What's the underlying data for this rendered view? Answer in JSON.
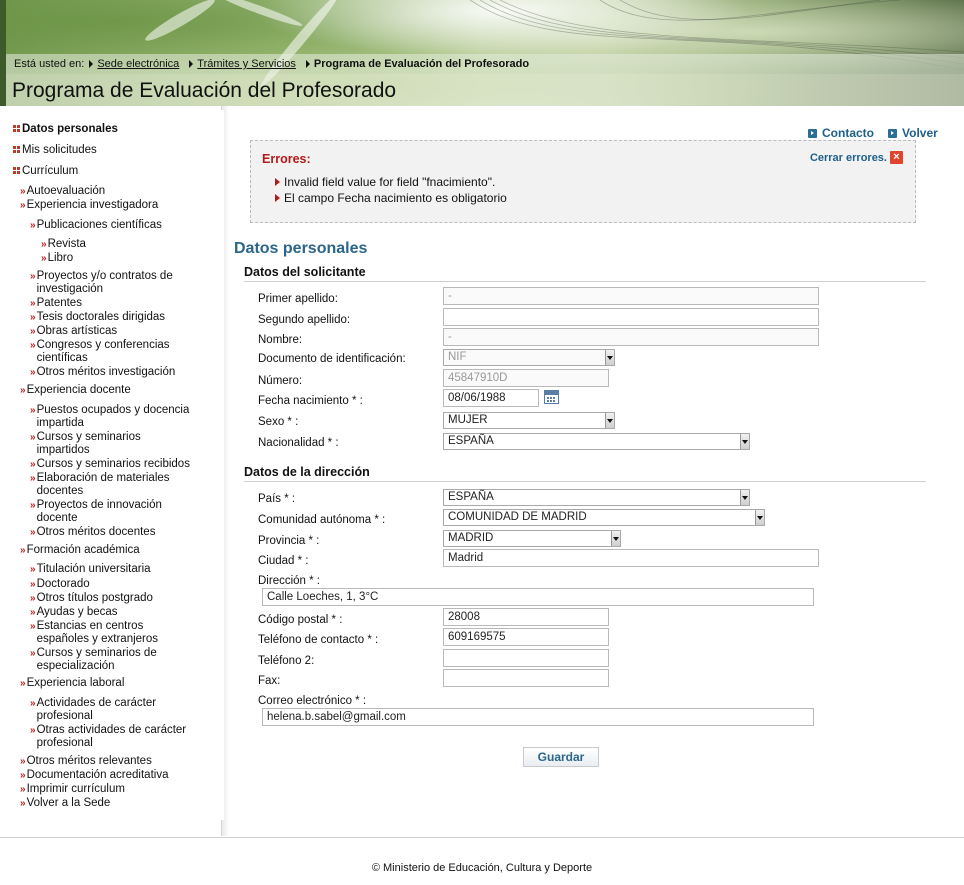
{
  "breadcrumb": {
    "prefix": "Está usted en:",
    "items": [
      "Sede electrónica",
      "Trámites y Servicios"
    ],
    "current": "Programa de Evaluación del Profesorado"
  },
  "page_title": "Programa de Evaluación del Profesorado",
  "sidebar": {
    "items": [
      {
        "label": "Datos personales"
      },
      {
        "label": "Mis solicitudes"
      },
      {
        "label": "Currículum"
      },
      {
        "label": "Autoevaluación"
      },
      {
        "label": "Experiencia investigadora"
      },
      {
        "label": "Publicaciones científicas"
      },
      {
        "label": "Revista"
      },
      {
        "label": "Libro"
      },
      {
        "label": "Proyectos y/o contratos de investigación"
      },
      {
        "label": "Patentes"
      },
      {
        "label": "Tesis doctorales dirigidas"
      },
      {
        "label": "Obras artísticas"
      },
      {
        "label": "Congresos y conferencias científicas"
      },
      {
        "label": "Otros méritos investigación"
      },
      {
        "label": "Experiencia docente"
      },
      {
        "label": "Puestos ocupados y docencia impartida"
      },
      {
        "label": "Cursos y seminarios impartidos"
      },
      {
        "label": "Cursos y seminarios recibidos"
      },
      {
        "label": "Elaboración de materiales docentes"
      },
      {
        "label": "Proyectos de innovación docente"
      },
      {
        "label": "Otros méritos docentes"
      },
      {
        "label": "Formación académica"
      },
      {
        "label": "Titulación universitaria"
      },
      {
        "label": "Doctorado"
      },
      {
        "label": "Otros títulos postgrado"
      },
      {
        "label": "Ayudas y becas"
      },
      {
        "label": "Estancias en centros españoles y extranjeros"
      },
      {
        "label": "Cursos y seminarios de especialización"
      },
      {
        "label": "Experiencia laboral"
      },
      {
        "label": "Actividades de carácter profesional"
      },
      {
        "label": "Otras actividades de carácter profesional"
      },
      {
        "label": "Otros méritos relevantes"
      },
      {
        "label": "Documentación acreditativa"
      },
      {
        "label": "Imprimir currículum"
      },
      {
        "label": "Volver a la Sede"
      }
    ]
  },
  "toplinks": {
    "contacto": "Contacto",
    "volver": "Volver"
  },
  "errors": {
    "title": "Errores:",
    "close_label": "Cerrar errores.",
    "messages": [
      "Invalid field value for field \"fnacimiento\".",
      "El campo Fecha nacimiento es obligatorio"
    ]
  },
  "form": {
    "title": "Datos personales",
    "solicitante": {
      "heading": "Datos del solicitante",
      "primer_apellido": {
        "label": "Primer apellido:",
        "value": "-"
      },
      "segundo_apellido": {
        "label": "Segundo apellido:",
        "value": ""
      },
      "nombre": {
        "label": "Nombre:",
        "value": "-"
      },
      "documento": {
        "label": "Documento de identificación:",
        "value": "NIF"
      },
      "numero": {
        "label": "Número:",
        "value": "45847910D"
      },
      "fecha_nacimiento": {
        "label": "Fecha nacimiento * :",
        "value": "08/06/1988"
      },
      "sexo": {
        "label": "Sexo * :",
        "value": "MUJER"
      },
      "nacionalidad": {
        "label": "Nacionalidad * :",
        "value": "ESPAÑA"
      }
    },
    "direccion": {
      "heading": "Datos de la dirección",
      "pais": {
        "label": "País * :",
        "value": "ESPAÑA"
      },
      "comunidad": {
        "label": "Comunidad autónoma * :",
        "value": "COMUNIDAD DE MADRID"
      },
      "provincia": {
        "label": "Provincia * :",
        "value": "MADRID"
      },
      "ciudad": {
        "label": "Ciudad * :",
        "value": "Madrid"
      },
      "direccion": {
        "label": "Dirección * :",
        "value": "Calle Loeches, 1, 3°C"
      },
      "codigo_postal": {
        "label": "Código postal * :",
        "value": "28008"
      },
      "telefono": {
        "label": "Teléfono de contacto * :",
        "value": "609169575"
      },
      "telefono2": {
        "label": "Teléfono 2:",
        "value": ""
      },
      "fax": {
        "label": "Fax:",
        "value": ""
      },
      "correo": {
        "label": "Correo electrónico * :",
        "value": "helena.b.sabel@gmail.com"
      }
    },
    "save_label": "Guardar"
  },
  "footer": "© Ministerio de Educación, Cultura y Deporte"
}
